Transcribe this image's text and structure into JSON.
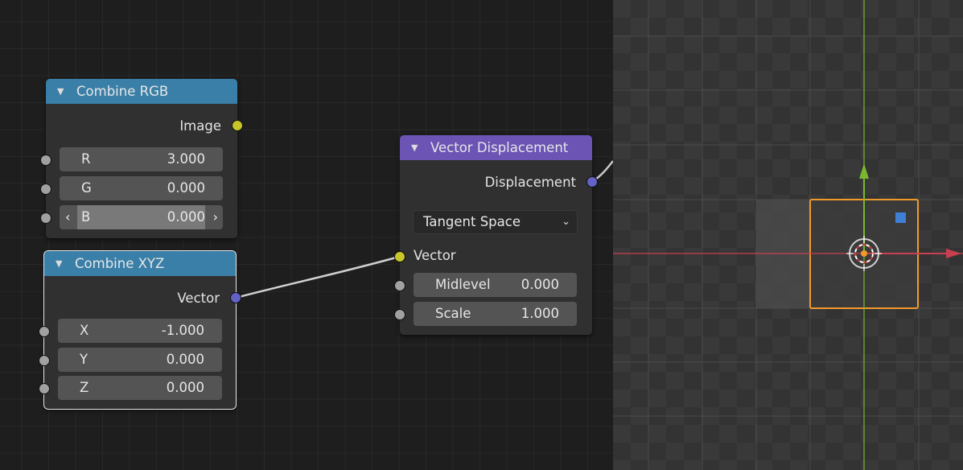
{
  "node_editor": {
    "combine_rgb": {
      "title": "Combine RGB",
      "output_label": "Image",
      "inputs": [
        {
          "label": "R",
          "value": "3.000"
        },
        {
          "label": "G",
          "value": "0.000"
        },
        {
          "label": "B",
          "value": "0.000"
        }
      ],
      "left_arrow": "‹",
      "right_arrow": "›"
    },
    "combine_xyz": {
      "title": "Combine XYZ",
      "output_label": "Vector",
      "inputs": [
        {
          "label": "X",
          "value": "-1.000"
        },
        {
          "label": "Y",
          "value": "0.000"
        },
        {
          "label": "Z",
          "value": "0.000"
        }
      ]
    },
    "vector_displacement": {
      "title": "Vector Displacement",
      "output_label": "Displacement",
      "space_selected": "Tangent Space",
      "vector_label": "Vector",
      "inputs": [
        {
          "label": "Midlevel",
          "value": "0.000"
        },
        {
          "label": "Scale",
          "value": "1.000"
        }
      ]
    },
    "icons": {
      "collapse": "▼",
      "dropdown": "⌄"
    }
  },
  "colors": {
    "converter_header": "#3a7fa8",
    "vector_header": "#6c54b5",
    "socket_color": "#c7c729",
    "socket_vector": "#6363c7",
    "socket_float": "#a1a1a1",
    "axis_x": "#c8404f",
    "axis_y": "#7ab62f",
    "selection_outline": "#f09a2c",
    "gizmo_blue": "#3f7fd6"
  }
}
